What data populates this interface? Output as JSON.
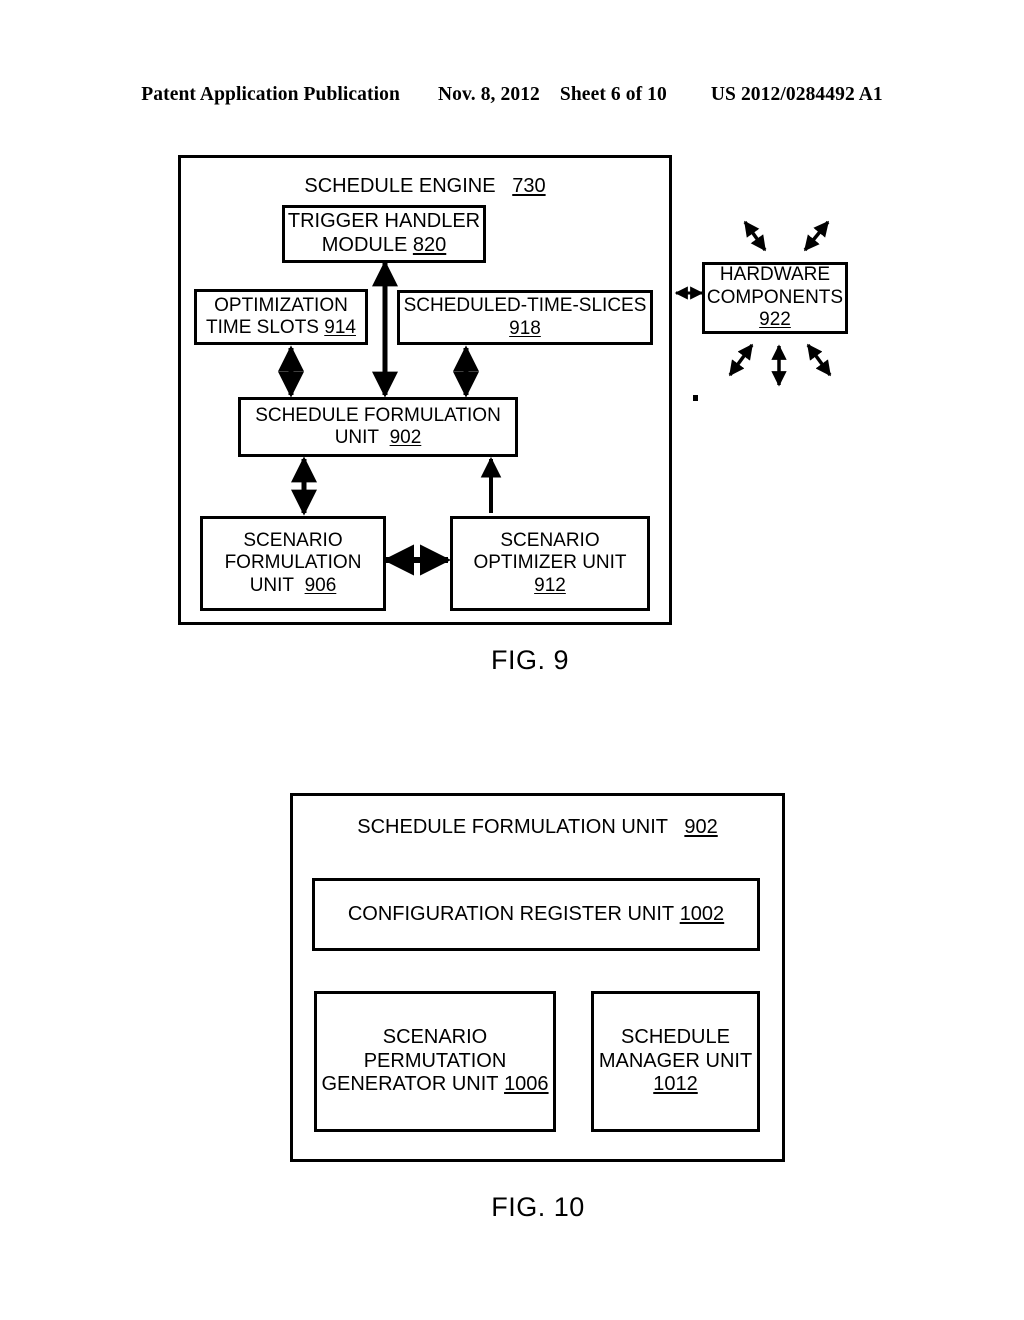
{
  "header": {
    "publication": "Patent Application Publication",
    "date": "Nov. 8, 2012",
    "sheet": "Sheet 6 of 10",
    "pub_number": "US 2012/0284492 A1"
  },
  "figures": [
    {
      "caption": "FIG. 9",
      "title_line": "SCHEDULE ENGINE",
      "title_ref": "730",
      "blocks": [
        {
          "name": "trigger-handler-module",
          "line1": "TRIGGER HANDLER",
          "line2": "MODULE",
          "ref": "820"
        },
        {
          "name": "optimization-time-slots",
          "line1": "OPTIMIZATION",
          "line2": "TIME SLOTS",
          "ref": "914"
        },
        {
          "name": "scheduled-time-slices",
          "line1": "SCHEDULED-TIME-SLICES",
          "line2": "",
          "ref": "918"
        },
        {
          "name": "schedule-formulation-unit",
          "line1": "SCHEDULE FORMULATION",
          "line2": "UNIT",
          "ref": "902"
        },
        {
          "name": "scenario-formulation-unit",
          "line1": "SCENARIO",
          "line2": "FORMULATION",
          "line3": "UNIT",
          "ref": "906"
        },
        {
          "name": "scenario-optimizer-unit",
          "line1": "SCENARIO",
          "line2": "OPTIMIZER UNIT",
          "ref": "912"
        },
        {
          "name": "hardware-components",
          "line1": "HARDWARE",
          "line2": "COMPONENTS",
          "ref": "922"
        }
      ]
    },
    {
      "caption": "FIG. 10",
      "title_line": "SCHEDULE FORMULATION UNIT",
      "title_ref": "902",
      "blocks": [
        {
          "name": "configuration-register-unit",
          "line1": "CONFIGURATION REGISTER UNIT",
          "ref": "1002"
        },
        {
          "name": "scenario-permutation-generator-unit",
          "line1": "SCENARIO",
          "line2": "PERMUTATION",
          "line3": "GENERATOR UNIT",
          "ref": "1006"
        },
        {
          "name": "schedule-manager-unit",
          "line1": "SCHEDULE",
          "line2": "MANAGER UNIT",
          "ref": "1012"
        }
      ]
    }
  ],
  "colors": {
    "ink": "#000000",
    "paper": "#ffffff"
  }
}
